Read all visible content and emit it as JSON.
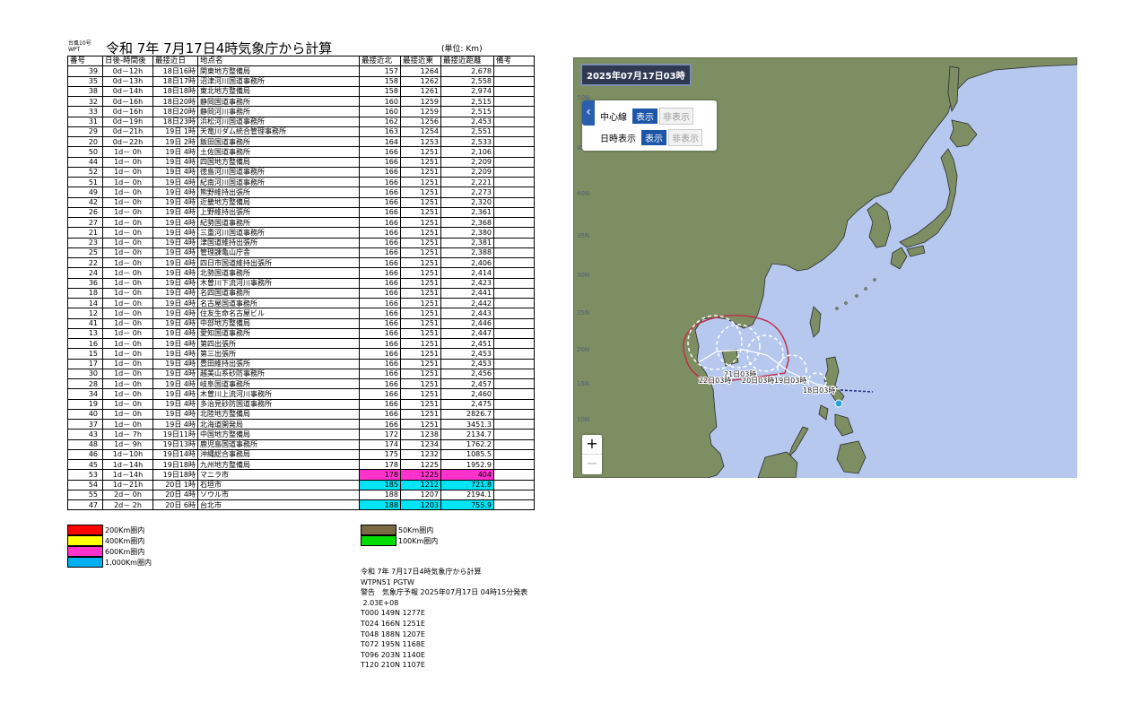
{
  "header": {
    "small_label": "台風10号 WPT",
    "title": "令和 7年 7月17日4時気象庁から計算",
    "unit": "(単位: Km)"
  },
  "table": {
    "columns": [
      "番号",
      "日後-時間後",
      "最接近日",
      "地点名",
      "最接近北",
      "最接近東",
      "最接近距離",
      "備考"
    ],
    "rows": [
      [
        "39",
        "0d－12h",
        "18日16時",
        "関東地方整備局",
        "157",
        "1264",
        "2,678",
        "",
        ""
      ],
      [
        "35",
        "0d－13h",
        "18日17時",
        "沼津河川国道事務所",
        "158",
        "1262",
        "2,558",
        "",
        ""
      ],
      [
        "38",
        "0d－14h",
        "18日18時",
        "東北地方整備局",
        "158",
        "1261",
        "2,974",
        "",
        ""
      ],
      [
        "32",
        "0d－16h",
        "18日20時",
        "静岡国道事務所",
        "160",
        "1259",
        "2,515",
        "",
        ""
      ],
      [
        "33",
        "0d－16h",
        "18日20時",
        "静岡河川事務所",
        "160",
        "1259",
        "2,515",
        "",
        ""
      ],
      [
        "31",
        "0d－19h",
        "18日23時",
        "浜松河川国道事務所",
        "162",
        "1256",
        "2,453",
        "",
        ""
      ],
      [
        "29",
        "0d－21h",
        "19日 1時",
        "天竜川ダム統合管理事務所",
        "163",
        "1254",
        "2,551",
        "",
        ""
      ],
      [
        "20",
        "0d－22h",
        "19日 2時",
        "飯田国道事務所",
        "164",
        "1253",
        "2,533",
        "",
        ""
      ],
      [
        "50",
        "1d－ 0h",
        "19日 4時",
        "土佐国道事務所",
        "166",
        "1251",
        "2,106",
        "",
        ""
      ],
      [
        "44",
        "1d－ 0h",
        "19日 4時",
        "四国地方整備局",
        "166",
        "1251",
        "2,209",
        "",
        ""
      ],
      [
        "52",
        "1d－ 0h",
        "19日 4時",
        "徳島河川国道事務所",
        "166",
        "1251",
        "2,209",
        "",
        ""
      ],
      [
        "51",
        "1d－ 0h",
        "19日 4時",
        "紀南河川国道事務所",
        "166",
        "1251",
        "2,221",
        "",
        ""
      ],
      [
        "49",
        "1d－ 0h",
        "19日 4時",
        "熊野維持出張所",
        "166",
        "1251",
        "2,273",
        "",
        ""
      ],
      [
        "42",
        "1d－ 0h",
        "19日 4時",
        "近畿地方整備局",
        "166",
        "1251",
        "2,320",
        "",
        ""
      ],
      [
        "26",
        "1d－ 0h",
        "19日 4時",
        "上野維持出張所",
        "166",
        "1251",
        "2,361",
        "",
        ""
      ],
      [
        "27",
        "1d－ 0h",
        "19日 4時",
        "紀勢国道事務所",
        "166",
        "1251",
        "2,368",
        "",
        ""
      ],
      [
        "21",
        "1d－ 0h",
        "19日 4時",
        "三重河川国道事務所",
        "166",
        "1251",
        "2,380",
        "",
        ""
      ],
      [
        "23",
        "1d－ 0h",
        "19日 4時",
        "津国道維持出張所",
        "166",
        "1251",
        "2,381",
        "",
        ""
      ],
      [
        "25",
        "1d－ 0h",
        "19日 4時",
        "管理課亀山庁舎",
        "166",
        "1251",
        "2,388",
        "",
        ""
      ],
      [
        "22",
        "1d－ 0h",
        "19日 4時",
        "四日市国道維持出張所",
        "166",
        "1251",
        "2,406",
        "",
        ""
      ],
      [
        "24",
        "1d－ 0h",
        "19日 4時",
        "北勢国道事務所",
        "166",
        "1251",
        "2,414",
        "",
        ""
      ],
      [
        "36",
        "1d－ 0h",
        "19日 4時",
        "木曽川下流河川事務所",
        "166",
        "1251",
        "2,423",
        "",
        ""
      ],
      [
        "18",
        "1d－ 0h",
        "19日 4時",
        "名四国道事務所",
        "166",
        "1251",
        "2,441",
        "",
        ""
      ],
      [
        "14",
        "1d－ 0h",
        "19日 4時",
        "名古屋国道事務所",
        "166",
        "1251",
        "2,442",
        "",
        ""
      ],
      [
        "12",
        "1d－ 0h",
        "19日 4時",
        "住友生命名古屋ビル",
        "166",
        "1251",
        "2,443",
        "",
        ""
      ],
      [
        "41",
        "1d－ 0h",
        "19日 4時",
        "中部地方整備局",
        "166",
        "1251",
        "2,446",
        "",
        ""
      ],
      [
        "13",
        "1d－ 0h",
        "19日 4時",
        "愛知国道事務所",
        "166",
        "1251",
        "2,447",
        "",
        ""
      ],
      [
        "16",
        "1d－ 0h",
        "19日 4時",
        "第四出張所",
        "166",
        "1251",
        "2,451",
        "",
        ""
      ],
      [
        "15",
        "1d－ 0h",
        "19日 4時",
        "第三出張所",
        "166",
        "1251",
        "2,453",
        "",
        ""
      ],
      [
        "17",
        "1d－ 0h",
        "19日 4時",
        "豊田維持出張所",
        "166",
        "1251",
        "2,453",
        "",
        ""
      ],
      [
        "30",
        "1d－ 0h",
        "19日 4時",
        "越美山系砂防事務所",
        "166",
        "1251",
        "2,456",
        "",
        ""
      ],
      [
        "28",
        "1d－ 0h",
        "19日 4時",
        "岐阜国道事務所",
        "166",
        "1251",
        "2,457",
        "",
        ""
      ],
      [
        "34",
        "1d－ 0h",
        "19日 4時",
        "木曽川上流河川事務所",
        "166",
        "1251",
        "2,460",
        "",
        ""
      ],
      [
        "19",
        "1d－ 0h",
        "19日 4時",
        "多治見砂防国道事務所",
        "166",
        "1251",
        "2,475",
        "",
        ""
      ],
      [
        "40",
        "1d－ 0h",
        "19日 4時",
        "北陸地方整備局",
        "166",
        "1251",
        "2826.7",
        "",
        ""
      ],
      [
        "37",
        "1d－ 0h",
        "19日 4時",
        "北海道開発局",
        "166",
        "1251",
        "3451.3",
        "",
        ""
      ],
      [
        "43",
        "1d－ 7h",
        "19日11時",
        "中国地方整備局",
        "172",
        "1238",
        "2134.7",
        "",
        ""
      ],
      [
        "48",
        "1d－ 9h",
        "19日13時",
        "鹿児島国道事務所",
        "174",
        "1234",
        "1762.2",
        "",
        ""
      ],
      [
        "46",
        "1d－10h",
        "19日14時",
        "沖縄総合事務局",
        "175",
        "1232",
        "1085.5",
        "",
        ""
      ],
      [
        "45",
        "1d－14h",
        "19日18時",
        "九州地方整備局",
        "178",
        "1225",
        "1952.9",
        "",
        ""
      ],
      [
        "53",
        "1d－14h",
        "19日18時",
        "マニラ市",
        "178",
        "1225",
        "404",
        "",
        "mag"
      ],
      [
        "54",
        "1d－21h",
        "20日 1時",
        "石垣市",
        "185",
        "1212",
        "721.8",
        "",
        "cyan"
      ],
      [
        "55",
        "2d－ 0h",
        "20日 4時",
        "ソウル市",
        "188",
        "1207",
        "2194.1",
        "",
        ""
      ],
      [
        "47",
        "2d－ 2h",
        "20日 6時",
        "台北市",
        "188",
        "1203",
        "755.9",
        "",
        "cyan"
      ]
    ]
  },
  "legend": [
    {
      "label": "200Km圏内",
      "color": "#ff0000"
    },
    {
      "label": "400Km圏内",
      "color": "#ffff00"
    },
    {
      "label": "600Km圏内",
      "color": "#ff33cc"
    },
    {
      "label": "1,000Km圏内",
      "color": "#00b0f0"
    },
    {
      "label": "50Km圏内",
      "color": "#7a6a44"
    },
    {
      "label": "100Km圏内",
      "color": "#00dd00"
    }
  ],
  "footer": {
    "lines": [
      "令和 7年 7月17日4時気象庁から計算",
      "WTPN51 PGTW",
      "警告　気象庁予報 2025年07月17日 04時15分発表",
      " 2.03E+08",
      "T000 149N 1277E",
      "T024 166N 1251E",
      "T048 188N 1207E",
      "T072 195N 1168E",
      "T096 203N 1140E",
      "T120 210N 1107E"
    ]
  },
  "map": {
    "date_label": "2025年07月17日03時",
    "panel": {
      "center_line_label": "中心線",
      "datetime_label": "日時表示",
      "show": "表示",
      "hide": "非表示"
    },
    "lat_labels": [
      "50N",
      "45N",
      "40N",
      "35N",
      "30N",
      "25N",
      "20N",
      "15N",
      "10N"
    ],
    "track_labels": [
      "21日03時",
      "22日03時",
      "20日03時",
      "19日03時",
      "18日03時"
    ],
    "zoom_in": "+",
    "zoom_out": "−",
    "colors": {
      "sea": "#b6c8ee",
      "land": "#7d8e63",
      "forecast_circle": "#ffffff",
      "storm_area": "#c0304a"
    }
  }
}
